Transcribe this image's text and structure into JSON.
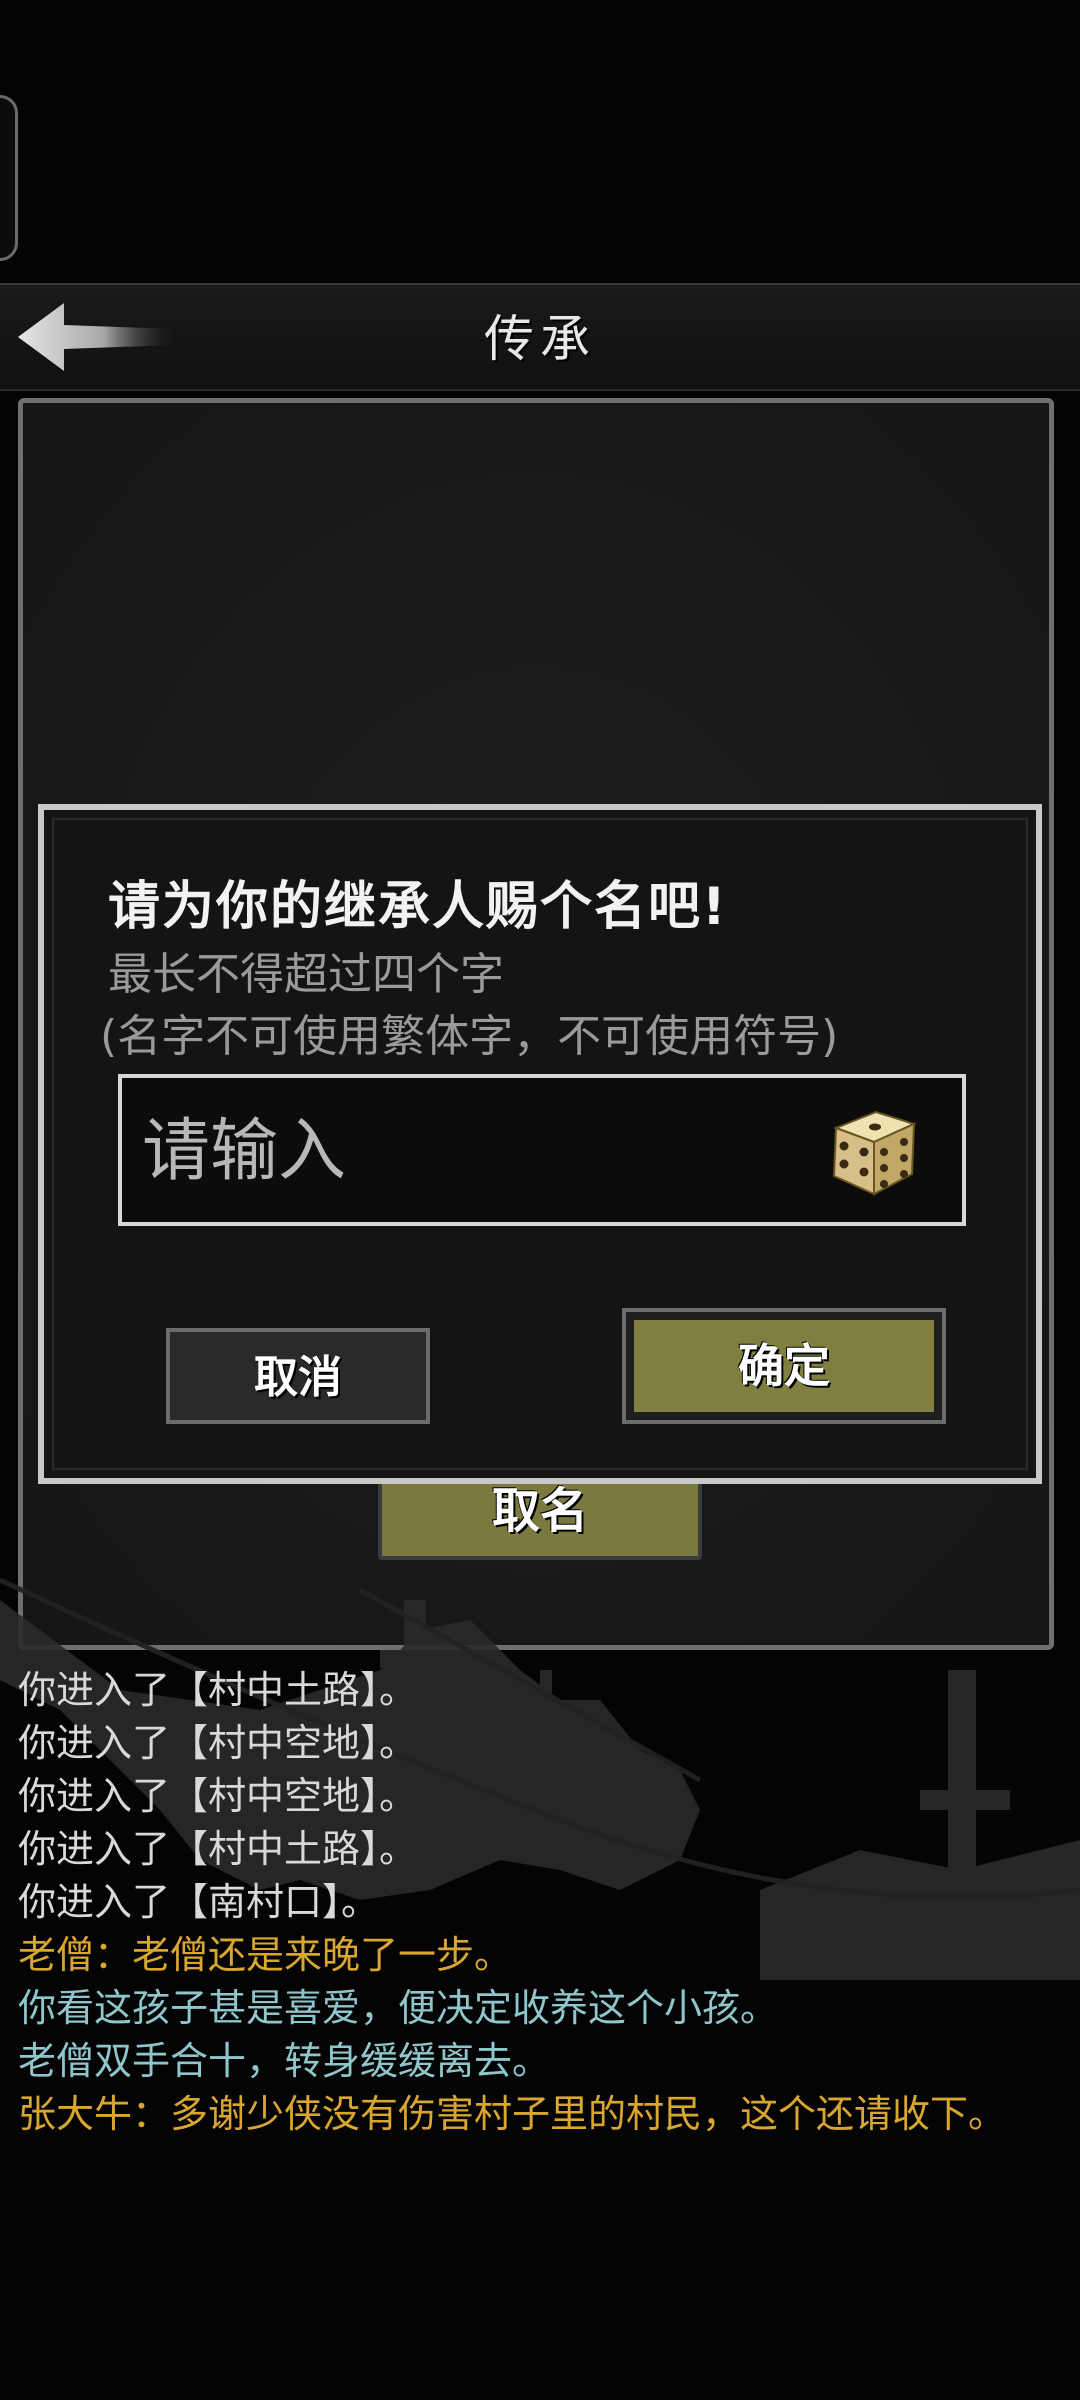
{
  "header": {
    "title": "传承"
  },
  "background_button": {
    "label": "取名"
  },
  "dialog": {
    "title": "请为你的继承人赐个名吧!",
    "subtitle_line1": "最长不得超过四个字",
    "subtitle_line2": "(名字不可使用繁体字，不可使用符号)",
    "input": {
      "value": "",
      "placeholder": "请输入"
    },
    "cancel_label": "取消",
    "confirm_label": "确定"
  },
  "colors": {
    "confirm_button": "#7f7f40",
    "log_system": "#d9d9d9",
    "log_speech": "#d9a630",
    "log_narration": "#8fc6cc"
  },
  "log": [
    {
      "text": "你进入了【村中土路】。",
      "type": "system"
    },
    {
      "text": "你进入了【村中空地】。",
      "type": "system"
    },
    {
      "text": "你进入了【村中空地】。",
      "type": "system"
    },
    {
      "text": "你进入了【村中土路】。",
      "type": "system"
    },
    {
      "text": "你进入了【南村口】。",
      "type": "system"
    },
    {
      "text": "老僧：老僧还是来晚了一步。",
      "type": "speech"
    },
    {
      "text": "你看这孩子甚是喜爱，便决定收养这个小孩。",
      "type": "narration"
    },
    {
      "text": "老僧双手合十，转身缓缓离去。",
      "type": "narration"
    },
    {
      "text": "张大牛：多谢少侠没有伤害村子里的村民，这个还请收下。",
      "type": "speech"
    }
  ]
}
